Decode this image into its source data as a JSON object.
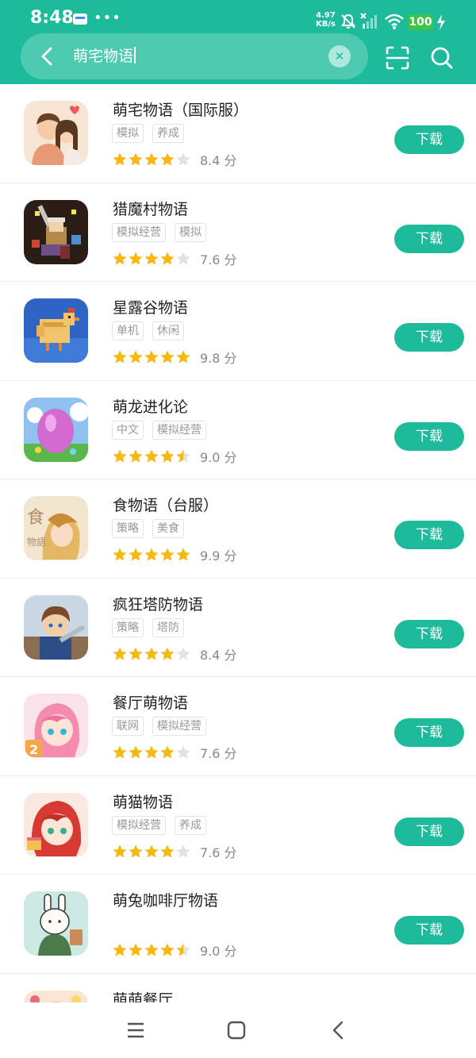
{
  "status_bar": {
    "time": "8:48",
    "net_speed_value": "4.97",
    "net_speed_unit": "KB/s",
    "battery": "100"
  },
  "search": {
    "query": "萌宅物语"
  },
  "colors": {
    "accent": "#1dbb9b",
    "star": "#f8b814",
    "star_empty": "#e2e2e2",
    "battery": "#3ec24a"
  },
  "apps": [
    {
      "name": "萌宅物语（国际服）",
      "tags": [
        "模拟",
        "养成"
      ],
      "stars": 4,
      "score": "8.4 分",
      "button": "下载",
      "icon": "couple-hug-icon"
    },
    {
      "name": "猎魔村物语",
      "tags": [
        "模拟经营",
        "模拟"
      ],
      "stars": 4,
      "score": "7.6 分",
      "button": "下载",
      "icon": "pixel-warrior-icon"
    },
    {
      "name": "星露谷物语",
      "tags": [
        "单机",
        "休闲"
      ],
      "stars": 5,
      "score": "9.8 分",
      "button": "下载",
      "icon": "pixel-chicken-icon"
    },
    {
      "name": "萌龙进化论",
      "tags": [
        "中文",
        "模拟经营"
      ],
      "stars": 4.5,
      "score": "9.0 分",
      "button": "下载",
      "icon": "dragon-egg-icon"
    },
    {
      "name": "食物语（台服）",
      "tags": [
        "策略",
        "美食"
      ],
      "stars": 5,
      "score": "9.9 分",
      "button": "下载",
      "icon": "anime-boy-icon"
    },
    {
      "name": "疯狂塔防物语",
      "tags": [
        "策略",
        "塔防"
      ],
      "stars": 4,
      "score": "8.4 分",
      "button": "下载",
      "icon": "hero-knight-icon"
    },
    {
      "name": "餐厅萌物语",
      "tags": [
        "联网",
        "模拟经营"
      ],
      "stars": 4,
      "score": "7.6 分",
      "button": "下载",
      "icon": "pink-hair-girl-icon"
    },
    {
      "name": "萌猫物语",
      "tags": [
        "模拟经营",
        "养成"
      ],
      "stars": 4,
      "score": "7.6 分",
      "button": "下载",
      "icon": "red-hair-girl-icon"
    },
    {
      "name": "萌兔咖啡厅物语",
      "tags": [],
      "stars": 4.5,
      "score": "9.0 分",
      "button": "下载",
      "icon": "rabbit-barista-icon"
    },
    {
      "name": "萌萌餐厅",
      "tags": [],
      "stars": 0,
      "score": "",
      "button": "",
      "icon": "restaurant-icon"
    }
  ],
  "nav": [
    "menu-icon",
    "home-icon",
    "back-icon"
  ]
}
